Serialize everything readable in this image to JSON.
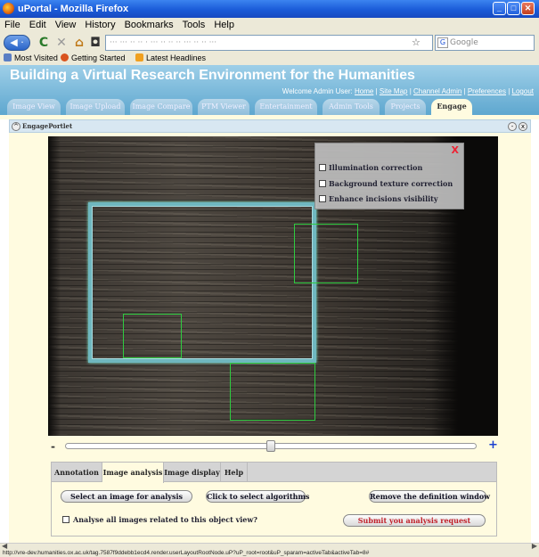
{
  "window": {
    "title": "uPortal - Mozilla Firefox"
  },
  "menu": [
    "File",
    "Edit",
    "View",
    "History",
    "Bookmarks",
    "Tools",
    "Help"
  ],
  "navbar": {
    "url_text": "··· ··· ·· ·· · ··· ·· ·· ·· ··· ·· ·· ···",
    "search_placeholder": "Google"
  },
  "bookmarks": [
    "Most Visited",
    "Getting Started",
    "Latest Headlines"
  ],
  "portal": {
    "title": "Building a Virtual Research Environment for the Humanities",
    "welcome_prefix": "Welcome Admin User:",
    "links": [
      "Home",
      "Site Map",
      "Channel Admin",
      "Preferences",
      "Logout"
    ],
    "separator": "|"
  },
  "tabs": [
    {
      "label": "Image View"
    },
    {
      "label": "Image Upload"
    },
    {
      "label": "Image Compare"
    },
    {
      "label": "PTM Viewer"
    },
    {
      "label": "Entertainment"
    },
    {
      "label": "Admin Tools"
    },
    {
      "label": "Projects"
    },
    {
      "label": "Engage"
    }
  ],
  "active_tab": "Engage",
  "portlet": {
    "title": "EngagePortlet"
  },
  "image_options": {
    "close_label": "X",
    "options": [
      {
        "label": "Illumination correction",
        "checked": false
      },
      {
        "label": "Background texture correction",
        "checked": false
      },
      {
        "label": "Enhance incisions visibility",
        "checked": false
      }
    ]
  },
  "zoom": {
    "minus": "-",
    "plus": "+",
    "level": 0.5
  },
  "analysis": {
    "tabs": [
      "Annotation",
      "Image analysis",
      "Image display",
      "Help"
    ],
    "active_tab": "Image analysis",
    "buttons": {
      "select_image": "Select an image for analysis",
      "select_algorithms": "Click to select algorithms",
      "remove_definition": "Remove the definition window",
      "submit": "Submit you analysis request"
    },
    "analyse_all": {
      "label": "Analyse all images related to this object view?",
      "checked": false
    }
  },
  "status": {
    "text": "http://vre-dev.humanities.ox.ac.uk/tag.7587f9ddebb1ecd4.render.userLayoutRootNode.uP?uP_root=root&uP_sparam=activeTab&activeTab=8#"
  },
  "colors": {
    "header": "#5ea7cf",
    "portlet_bg": "#fffbe0",
    "roi_main": "#6fb7bf",
    "roi_small": "#2ecc40",
    "submit_text": "#c0202a"
  }
}
